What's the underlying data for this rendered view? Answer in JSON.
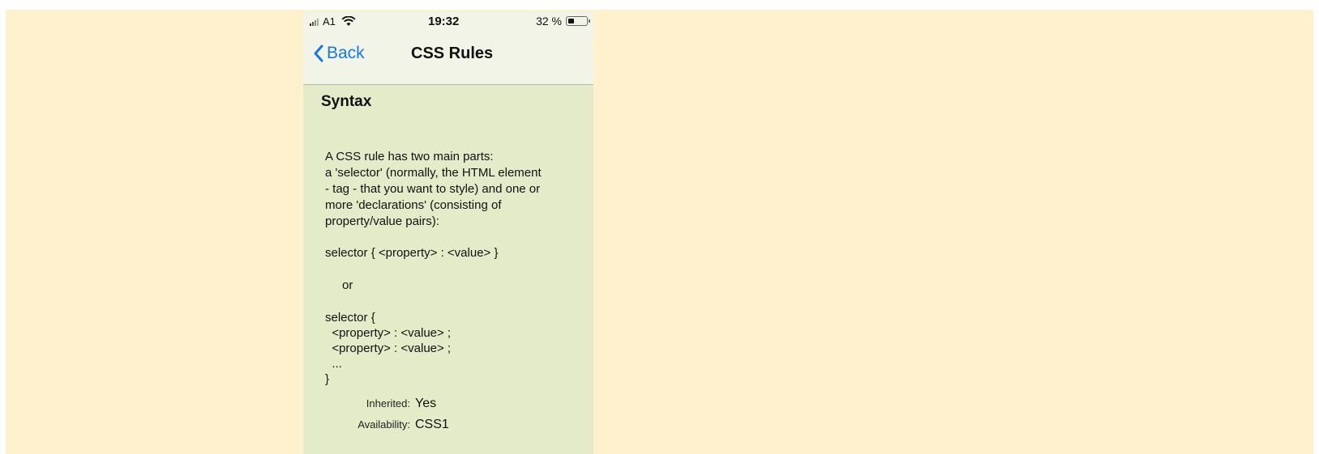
{
  "status_bar": {
    "carrier": "A1",
    "time": "19:32",
    "battery_percent": "32 %",
    "battery_level": 0.32,
    "signal_icon": "signal-icon",
    "wifi_icon": "wifi-icon",
    "battery_icon": "battery-icon"
  },
  "navigation": {
    "back_label": "Back",
    "title": "CSS Rules",
    "back_icon": "chevron-left-icon"
  },
  "section": {
    "title": "Syntax"
  },
  "content": {
    "intro": "A CSS rule has two main parts:\na 'selector' (normally, the HTML element\n- tag - that you want to style) and one or\nmore 'declarations' (consisting of\nproperty/value pairs):",
    "one_line_syntax": "selector { <property> : <value> }",
    "or": "or",
    "block_syntax": "selector {\n  <property> : <value> ;\n  <property> : <value> ;\n  ...\n}"
  },
  "metadata": {
    "inherited_label": "Inherited:",
    "inherited_value": "Yes",
    "availability_label": "Availability:",
    "availability_value": "CSS1"
  },
  "colors": {
    "page_background": "#fff1ce",
    "phone_background": "#e4ebc9",
    "bar_background": "#f2f4e8",
    "accent": "#1577e8"
  }
}
